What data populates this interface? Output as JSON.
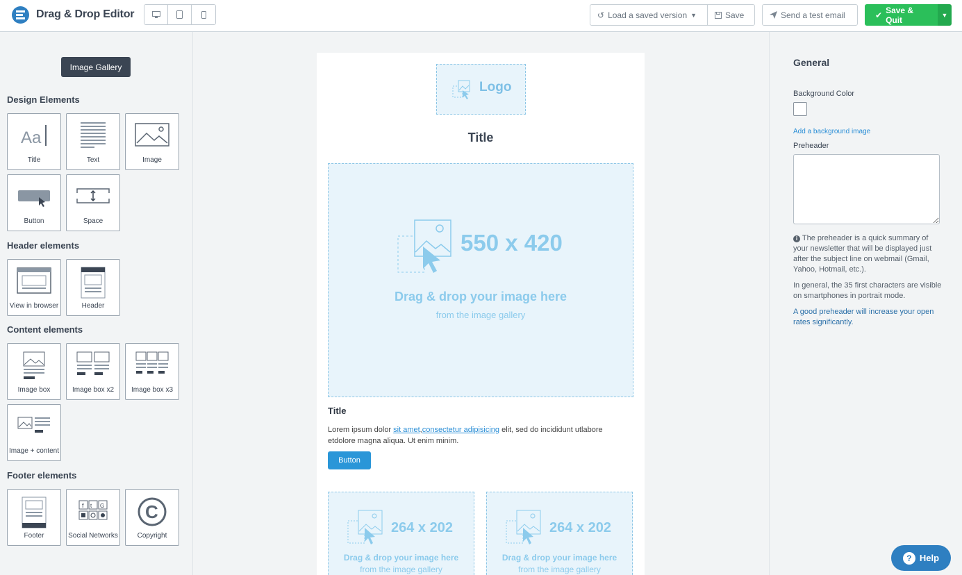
{
  "header": {
    "app_title": "Drag & Drop Editor",
    "device_buttons": [
      "desktop-icon",
      "tablet-icon",
      "mobile-icon"
    ],
    "load_label": "Load a saved version",
    "save_label": "Save",
    "test_label": "Send a test email",
    "quit_label": "Save & Quit"
  },
  "sidebar": {
    "gallery_label": "Image Gallery",
    "sections": {
      "design": "Design Elements",
      "header": "Header elements",
      "content": "Content elements",
      "footer": "Footer elements"
    },
    "design_items": [
      "Title",
      "Text",
      "Image",
      "Button",
      "Space"
    ],
    "header_items": [
      "View in browser",
      "Header"
    ],
    "content_items": [
      "Image box",
      "Image box x2",
      "Image box x3",
      "Image + content"
    ],
    "footer_items": [
      "Footer",
      "Social Networks",
      "Copyright"
    ]
  },
  "email": {
    "logo_text": "Logo",
    "title": "Title",
    "main_image": {
      "dimensions": "550 x 420",
      "drag_text": "Drag & drop your image here",
      "from_text": "from the image gallery"
    },
    "content_title": "Title",
    "lorem_before": "Lorem ipsum dolor ",
    "lorem_link1": "sit amet",
    "lorem_comma": ",",
    "lorem_link2": "consectetur adipisicing",
    "lorem_after": " elit, sed do incididunt utlabore etdolore magna aliqua. Ut enim minim.",
    "button_label": "Button",
    "small_images": [
      {
        "dimensions": "264 x 202",
        "drag_text": "Drag & drop your image here",
        "from_text": "from the image gallery"
      },
      {
        "dimensions": "264 x 202",
        "drag_text": "Drag & drop your image here",
        "from_text": "from the image gallery"
      }
    ]
  },
  "panel": {
    "title": "General",
    "bg_color_label": "Background Color",
    "bg_color_value": "#ffffff",
    "add_bg_image": "Add a background image",
    "preheader_label": "Preheader",
    "preheader_value": "",
    "info1": "The preheader is a quick summary of your newsletter that will be displayed just after the subject line on webmail (Gmail, Yahoo, Hotmail, etc.).",
    "info2": "In general, the 35 first characters are visible on smartphones in portrait mode.",
    "info3": "A good preheader will increase your open rates significantly."
  },
  "help_label": "Help",
  "colors": {
    "accent_green": "#2bbf5a",
    "accent_blue": "#2a96d8",
    "placeholder_blue": "#8ccbec",
    "dark": "#3b4553"
  }
}
